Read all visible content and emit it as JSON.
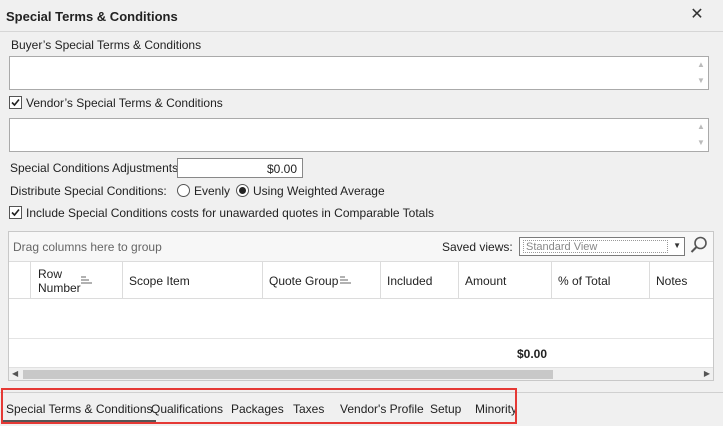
{
  "window": {
    "title": "Special Terms & Conditions"
  },
  "buyer": {
    "label": "Buyer’s Special Terms & Conditions",
    "value": ""
  },
  "vendor": {
    "label": "Vendor’s Special Terms & Conditions",
    "checked": true,
    "value": ""
  },
  "adjustments": {
    "label": "Special Conditions Adjustments:",
    "value": "$0.00"
  },
  "distribute": {
    "label": "Distribute Special Conditions:",
    "options": [
      "Evenly",
      "Using Weighted Average"
    ],
    "selected": "Using Weighted Average"
  },
  "include": {
    "label": "Include Special Conditions costs for unawarded quotes in Comparable Totals",
    "checked": true
  },
  "grid": {
    "group_hint": "Drag columns here to group",
    "saved_views_label": "Saved views:",
    "saved_view_value": "Standard View",
    "columns": {
      "row_number_1": "Row",
      "row_number_2": "Number",
      "scope_item": "Scope Item",
      "quote_group": "Quote Group",
      "included": "Included",
      "amount": "Amount",
      "pct_total": "% of Total",
      "notes": "Notes"
    },
    "total_amount": "$0.00"
  },
  "tabs": [
    "Special Terms & Conditions",
    "Qualifications",
    "Packages",
    "Taxes",
    "Vendor's Profile",
    "Setup",
    "Minority"
  ],
  "active_tab": "Special Terms & Conditions",
  "colors": {
    "highlight": "#e53935",
    "background": "#f0f0f0"
  }
}
